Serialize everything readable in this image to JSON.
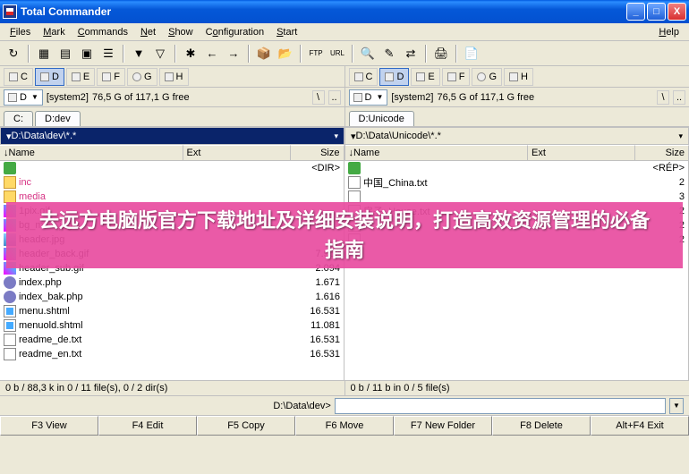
{
  "window": {
    "title": "Total Commander"
  },
  "menu": {
    "files": "Files",
    "mark": "Mark",
    "commands": "Commands",
    "net": "Net",
    "show": "Show",
    "configuration": "Configuration",
    "start": "Start",
    "help": "Help"
  },
  "drives": {
    "c": "C",
    "d": "D",
    "e": "E",
    "f": "F",
    "g": "G",
    "h": "H"
  },
  "left": {
    "drive_sel": "D",
    "drive_label": "[system2]",
    "space": "76,5 G of 117,1 G free",
    "tabs": [
      "C:",
      "D:dev"
    ],
    "active_tab": 1,
    "path": "D:\\Data\\dev\\*.*",
    "cols": {
      "name": "Name",
      "ext": "Ext",
      "size": "Size"
    },
    "files": [
      {
        "icon": "up",
        "name": "",
        "ext": "",
        "size": "<DIR>"
      },
      {
        "icon": "dir",
        "name": "inc",
        "ext": "",
        "size": "",
        "pink": true
      },
      {
        "icon": "dir",
        "name": "media",
        "ext": "",
        "size": "",
        "pink": true
      },
      {
        "icon": "gif",
        "name": "1pix.gif",
        "ext": "",
        "size": ""
      },
      {
        "icon": "gif",
        "name": "bg_main.jpg",
        "ext": "",
        "size": ""
      },
      {
        "icon": "jpg",
        "name": "header.jpg",
        "ext": "",
        "size": ""
      },
      {
        "icon": "gif",
        "name": "header_back.gif",
        "ext": "",
        "size": "7.968"
      },
      {
        "icon": "gif",
        "name": "header_sub.gif",
        "ext": "",
        "size": "2.094"
      },
      {
        "icon": "php",
        "name": "index.php",
        "ext": "",
        "size": "1.671"
      },
      {
        "icon": "php",
        "name": "index_bak.php",
        "ext": "",
        "size": "1.616"
      },
      {
        "icon": "html",
        "name": "menu.shtml",
        "ext": "",
        "size": "16.531"
      },
      {
        "icon": "html",
        "name": "menuold.shtml",
        "ext": "",
        "size": "11.081"
      },
      {
        "icon": "txt",
        "name": "readme_de.txt",
        "ext": "",
        "size": "16.531"
      },
      {
        "icon": "txt",
        "name": "readme_en.txt",
        "ext": "",
        "size": "16.531"
      }
    ],
    "status": "0 b / 88,3 k in 0 / 11 file(s), 0 / 2 dir(s)"
  },
  "right": {
    "drive_sel": "D",
    "drive_label": "[system2]",
    "space": "76,5 G of 117,1 G free",
    "tabs": [
      "D:Unicode"
    ],
    "active_tab": 0,
    "path": "D:\\Data\\Unicode\\*.*",
    "cols": {
      "name": "Name",
      "ext": "Ext",
      "size": "Size"
    },
    "files": [
      {
        "icon": "up",
        "name": "",
        "ext": "",
        "size": "<RÉP>"
      },
      {
        "icon": "txt",
        "name": "中国_China.txt",
        "ext": "",
        "size": "2"
      },
      {
        "icon": "txt",
        "name": "",
        "ext": "",
        "size": "3"
      },
      {
        "icon": "txt",
        "name": "房子_House.txt",
        "ext": "",
        "size": "2"
      },
      {
        "icon": "txt",
        "name": "",
        "ext": "",
        "size": "2"
      },
      {
        "icon": "txt",
        "name": "",
        "ext": "",
        "size": "2"
      }
    ],
    "status": "0 b / 11 b in 0 / 5 file(s)"
  },
  "cmd": {
    "prompt": "D:\\Data\\dev>"
  },
  "fn": {
    "f3": "F3 View",
    "f4": "F4 Edit",
    "f5": "F5 Copy",
    "f6": "F6 Move",
    "f7": "F7 New Folder",
    "f8": "F8 Delete",
    "altf4": "Alt+F4 Exit"
  },
  "overlay": {
    "text": "去远方电脑版官方下载地址及详细安装说明，打造高效资源管理的必备指南"
  }
}
